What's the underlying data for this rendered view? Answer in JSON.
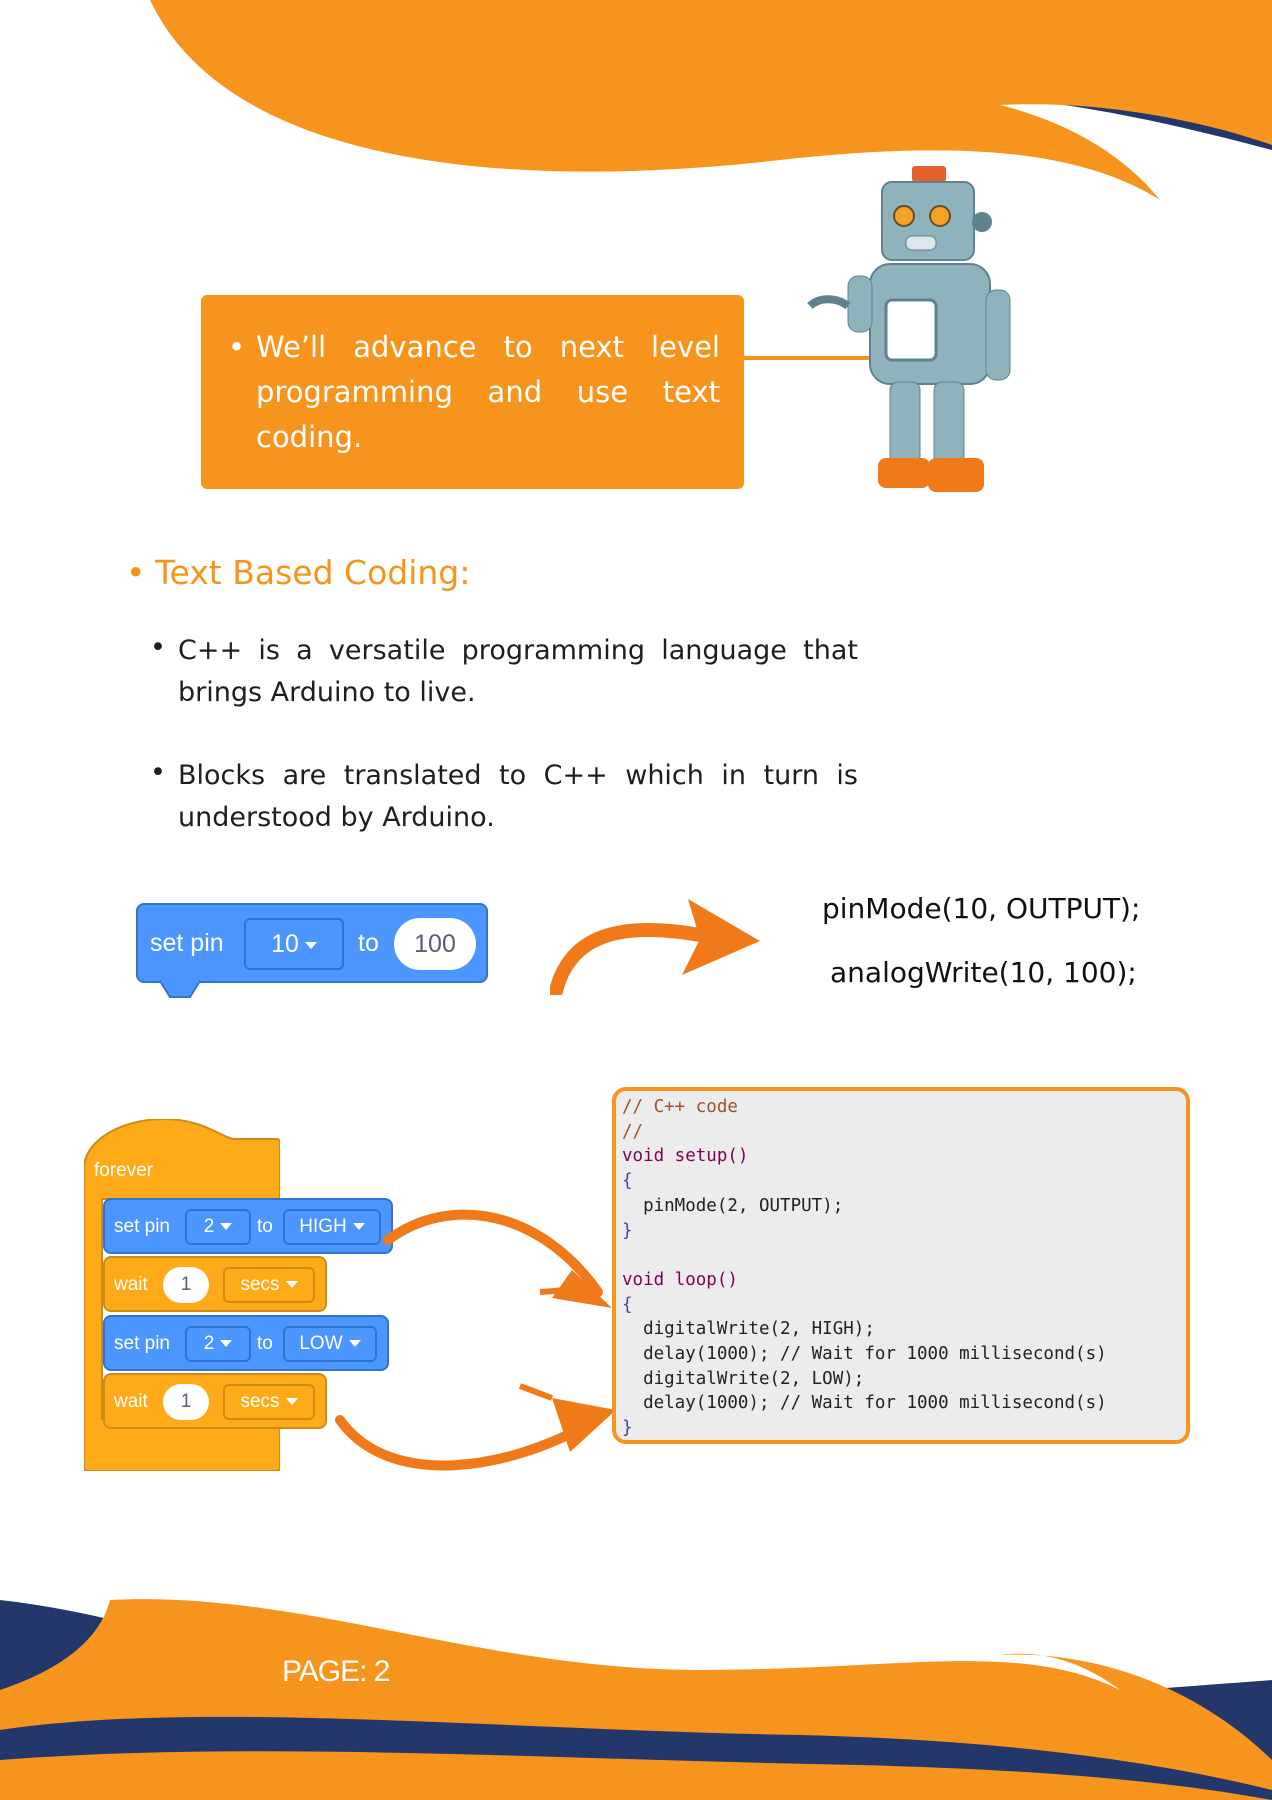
{
  "intro": {
    "text": "We’ll advance to next level programming and use text coding."
  },
  "section": {
    "heading": "Text Based Coding:",
    "bullets": [
      "C++ is a versatile programming language that brings Arduino to live.",
      "Blocks are translated to C++ which in turn is understood by Arduino."
    ]
  },
  "example1": {
    "block": {
      "set_label": "set pin",
      "pin": "10",
      "to_label": "to",
      "value": "100"
    },
    "code_lines": [
      "pinMode(10, OUTPUT);",
      "analogWrite(10, 100);"
    ]
  },
  "example2": {
    "forever_label": "forever",
    "blocks": [
      {
        "type": "set",
        "set_label": "set pin",
        "pin": "2",
        "to_label": "to",
        "value": "HIGH"
      },
      {
        "type": "wait",
        "wait_label": "wait",
        "amount": "1",
        "unit": "secs"
      },
      {
        "type": "set",
        "set_label": "set pin",
        "pin": "2",
        "to_label": "to",
        "value": "LOW"
      },
      {
        "type": "wait",
        "wait_label": "wait",
        "amount": "1",
        "unit": "secs"
      }
    ],
    "code": [
      "// C++ code",
      "//",
      "void setup()",
      "{",
      "  pinMode(2, OUTPUT);",
      "}",
      "",
      "void loop()",
      "{",
      "  digitalWrite(2, HIGH);",
      "  delay(1000); // Wait for 1000 millisecond(s)",
      "  digitalWrite(2, LOW);",
      "  delay(1000); // Wait for 1000 millisecond(s)",
      "}"
    ]
  },
  "footer": {
    "page_label": "PAGE: 2"
  },
  "colors": {
    "orange": "#f7941d",
    "navy": "#23376b",
    "block_blue": "#4c97ff",
    "block_orange": "#ffab19"
  },
  "illustration": {
    "robot": "robot-image"
  }
}
